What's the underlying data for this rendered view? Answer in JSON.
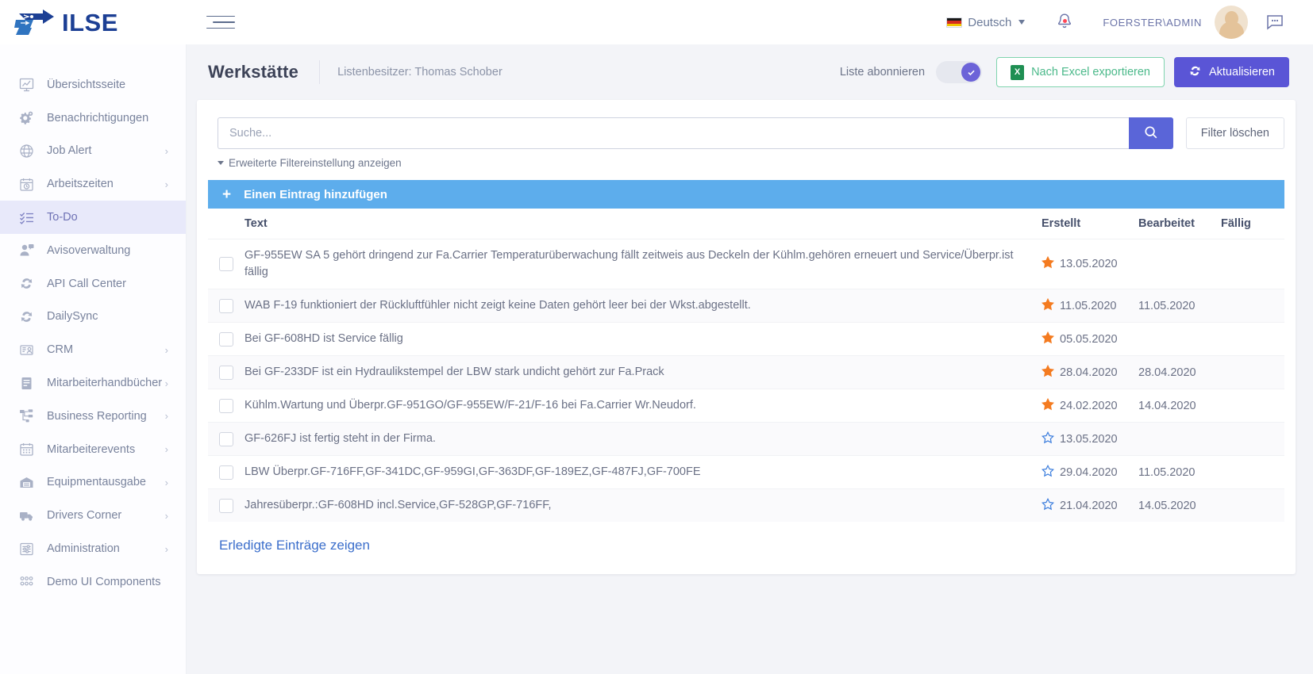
{
  "brand": {
    "name": "ILSE",
    "logo_icon": "ilse-arrow-logo"
  },
  "topbar": {
    "menu_toggle_icon": "hamburger-icon",
    "language": {
      "label": "Deutsch",
      "flag": "german-flag-icon",
      "caret_icon": "chevron-down-icon"
    },
    "notifications_icon": "bell-icon",
    "user_name": "FOERSTER\\ADMIN",
    "avatar_icon": "user-avatar",
    "chat_icon": "chat-bubble-icon"
  },
  "sidebar": {
    "items": [
      {
        "label": "Übersichtsseite",
        "icon": "dashboard-icon",
        "arrow": "",
        "active": false
      },
      {
        "label": "Benachrichtigungen",
        "icon": "gears-icon",
        "arrow": "",
        "active": false
      },
      {
        "label": "Job Alert",
        "icon": "globe-alert-icon",
        "arrow": "›",
        "active": false
      },
      {
        "label": "Arbeitszeiten",
        "icon": "calendar-clock-icon",
        "arrow": "›",
        "active": false
      },
      {
        "label": "To-Do",
        "icon": "checklist-icon",
        "arrow": "",
        "active": true
      },
      {
        "label": "Avisoverwaltung",
        "icon": "user-message-icon",
        "arrow": "",
        "active": false
      },
      {
        "label": "API Call Center",
        "icon": "sync-icon",
        "arrow": "",
        "active": false
      },
      {
        "label": "DailySync",
        "icon": "sync-icon",
        "arrow": "",
        "active": false
      },
      {
        "label": "CRM",
        "icon": "crm-icon",
        "arrow": "›",
        "active": false
      },
      {
        "label": "Mitarbeiterhandbücher",
        "icon": "book-icon",
        "arrow": "›",
        "active": false
      },
      {
        "label": "Business Reporting",
        "icon": "hierarchy-icon",
        "arrow": "›",
        "active": false
      },
      {
        "label": "Mitarbeiterevents",
        "icon": "calendar-icon",
        "arrow": "›",
        "active": false
      },
      {
        "label": "Equipmentausgabe",
        "icon": "warehouse-icon",
        "arrow": "›",
        "active": false
      },
      {
        "label": "Drivers Corner",
        "icon": "truck-icon",
        "arrow": "›",
        "active": false
      },
      {
        "label": "Administration",
        "icon": "sliders-icon",
        "arrow": "›",
        "active": false
      },
      {
        "label": "Demo UI Components",
        "icon": "dots-grid-icon",
        "arrow": "",
        "active": false
      }
    ]
  },
  "page": {
    "title": "Werkstätte",
    "owner_label": "Listenbesitzer: Thomas Schober",
    "subscribe_label": "Liste abonnieren",
    "subscribe_on": true,
    "subscribe_check_icon": "check-icon",
    "export_label": "Nach Excel exportieren",
    "export_icon": "excel-icon",
    "refresh_label": "Aktualisieren",
    "refresh_icon": "sync-icon"
  },
  "search": {
    "placeholder": "Suche...",
    "value": "",
    "search_icon": "search-icon",
    "clear_filter_label": "Filter löschen",
    "advanced_filter_label": "Erweiterte Filtereinstellung anzeigen",
    "advanced_filter_icon": "chevron-down-icon"
  },
  "add_bar": {
    "label": "Einen Eintrag hinzufügen",
    "icon": "plus-icon"
  },
  "table": {
    "columns": [
      "",
      "Text",
      "Erstellt",
      "Bearbeitet",
      "Fällig"
    ],
    "rows": [
      {
        "text": "GF-955EW SA 5 gehört dringend zur Fa.Carrier Temperaturüberwachung fällt zeitweis aus Deckeln der Kühlm.gehören erneuert und Service/Überpr.ist fällig",
        "star": "filled",
        "erstellt": "13.05.2020",
        "bearbeitet": "",
        "faellig": ""
      },
      {
        "text": "WAB F-19 funktioniert der Rückluftfühler nicht zeigt keine Daten  gehört leer bei der Wkst.abgestellt.",
        "star": "filled",
        "erstellt": "11.05.2020",
        "bearbeitet": "11.05.2020",
        "faellig": ""
      },
      {
        "text": "Bei GF-608HD ist Service fällig",
        "star": "filled",
        "erstellt": "05.05.2020",
        "bearbeitet": "",
        "faellig": ""
      },
      {
        "text": "Bei GF-233DF ist ein Hydraulikstempel der LBW stark undicht gehört zur Fa.Prack",
        "star": "filled",
        "erstellt": "28.04.2020",
        "bearbeitet": "28.04.2020",
        "faellig": ""
      },
      {
        "text": "Kühlm.Wartung und Überpr.GF-951GO/GF-955EW/F-21/F-16 bei Fa.Carrier Wr.Neudorf.",
        "star": "filled",
        "erstellt": "24.02.2020",
        "bearbeitet": "14.04.2020",
        "faellig": ""
      },
      {
        "text": "GF-626FJ ist fertig steht in der Firma.",
        "star": "outline",
        "erstellt": "13.05.2020",
        "bearbeitet": "",
        "faellig": ""
      },
      {
        "text": "LBW Überpr.GF-716FF,GF-341DC,GF-959GI,GF-363DF,GF-189EZ,GF-487FJ,GF-700FE",
        "star": "outline",
        "erstellt": "29.04.2020",
        "bearbeitet": "11.05.2020",
        "faellig": ""
      },
      {
        "text": "Jahresüberpr.:GF-608HD incl.Service,GF-528GP,GF-716FF,",
        "star": "outline",
        "erstellt": "21.04.2020",
        "bearbeitet": "14.05.2020",
        "faellig": ""
      }
    ]
  },
  "footer": {
    "show_done_label": "Erledigte Einträge zeigen"
  },
  "colors": {
    "accent": "#5a55d6",
    "add_bar": "#5dadec",
    "star_filled": "#f47b20",
    "star_outline": "#3b7ddd",
    "link": "#3b6ecb",
    "brand": "#1c3f94",
    "excel_green": "#4bb98a"
  }
}
